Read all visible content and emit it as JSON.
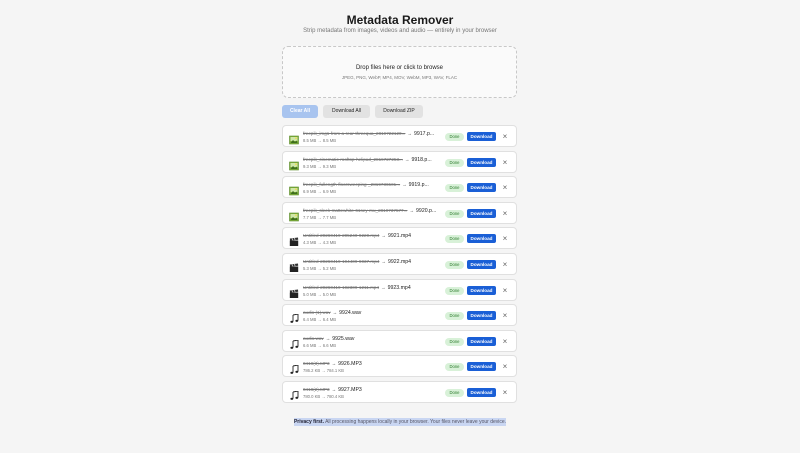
{
  "header": {
    "title": "Metadata Remover",
    "subtitle": "Strip metadata from images, videos and audio — entirely in your browser"
  },
  "dropzone": {
    "title": "Drop files here or click to browse",
    "formats": "JPEG, PNG, WebP, MP4, MOV, WebM, MP3, WAV, FLAC"
  },
  "toolbar": {
    "clear_label": "Clear All",
    "download_all_label": "Download All",
    "download_zip_label": "Download ZIP"
  },
  "files": [
    {
      "type": "image",
      "old_name": "freepik_img1-from-a-rear-threequa_2819722120...",
      "new_name": "9917.p...",
      "size": "8.5 MB → 8.5 MB",
      "status": "Done",
      "action": "Download"
    },
    {
      "type": "image",
      "old_name": "freepik_cinematic-rooftop-helipad_2819727253...",
      "new_name": "9918.p...",
      "size": "9.3 MB → 9.3 MB",
      "status": "Done",
      "action": "Download"
    },
    {
      "type": "image",
      "old_name": "freepik_fullength-floorsweeping-_2819736501...",
      "new_name": "9919.p...",
      "size": "6.9 MB → 6.9 MB",
      "status": "Done",
      "action": "Download"
    },
    {
      "type": "image",
      "old_name": "freepik_sleek-mattewhite-61sey-mu_2819737577...",
      "new_name": "9920.p...",
      "size": "7.7 MB → 7.7 MB",
      "status": "Done",
      "action": "Download"
    },
    {
      "type": "video",
      "old_name": "Untitled-20260419-205240-9220.mp4",
      "new_name": "9921.mp4",
      "size": "4.3 MB → 4.3 MB",
      "status": "Done",
      "action": "Download"
    },
    {
      "type": "video",
      "old_name": "Untitled-20260419-194409-9037.mp4",
      "new_name": "9922.mp4",
      "size": "5.3 MB → 5.2 MB",
      "status": "Done",
      "action": "Download"
    },
    {
      "type": "video",
      "old_name": "Untitled-20260419-192309-1211.mp4",
      "new_name": "9923.mp4",
      "size": "5.0 MB → 5.0 MB",
      "status": "Done",
      "action": "Download"
    },
    {
      "type": "audio",
      "old_name": "audio (1).wav",
      "new_name": "9924.wav",
      "size": "6.4 MB → 6.4 MB",
      "status": "Done",
      "action": "Download"
    },
    {
      "type": "audio",
      "old_name": "audio.wav",
      "new_name": "9925.wav",
      "size": "6.6 MB → 6.6 MB",
      "status": "Done",
      "action": "Download"
    },
    {
      "type": "audio",
      "old_name": "0418(3).MP3",
      "new_name": "9926.MP3",
      "size": "786.2 KB → 784.1 KB",
      "status": "Done",
      "action": "Download"
    },
    {
      "type": "audio",
      "old_name": "0418(2).MP3",
      "new_name": "9927.MP3",
      "size": "780.0 KB → 780.4 KB",
      "status": "Done",
      "action": "Download"
    }
  ],
  "footer": {
    "lead": "Privacy first.",
    "text": " All processing happens locally in your browser. Your files never leave your device."
  },
  "colors": {
    "primary": "#1a5fd6",
    "clear_button": "#a8c4ef",
    "done_badge_bg": "#d8f1d8",
    "done_badge_text": "#2a7a2a"
  }
}
